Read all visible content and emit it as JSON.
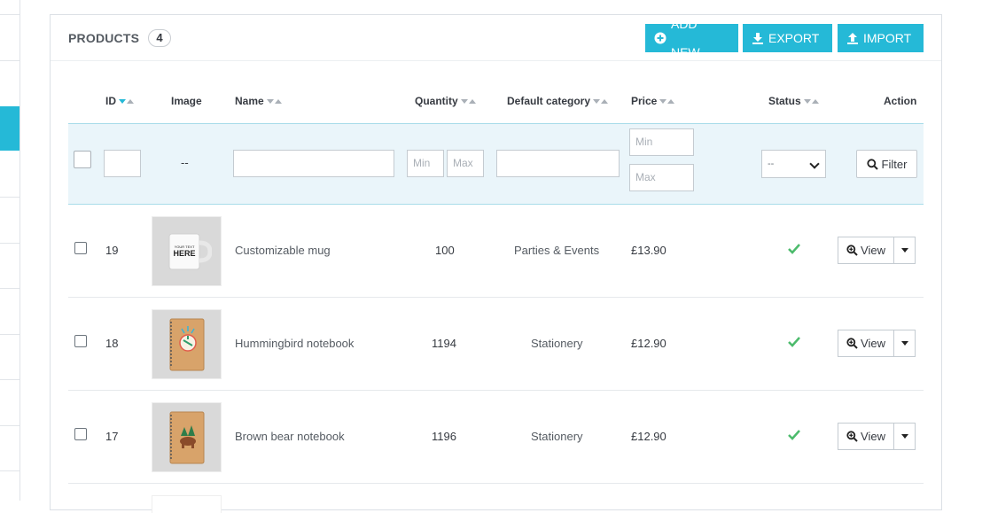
{
  "panel": {
    "title": "PRODUCTS",
    "count": "4",
    "buttons": {
      "add_new": "ADD NEW",
      "export": "EXPORT",
      "import": "IMPORT"
    }
  },
  "table": {
    "columns": {
      "id": "ID",
      "image": "Image",
      "name": "Name",
      "quantity": "Quantity",
      "category": "Default category",
      "price": "Price",
      "status": "Status",
      "action": "Action"
    },
    "filters": {
      "image_placeholder": "--",
      "qty_min_placeholder": "Min",
      "qty_max_placeholder": "Max",
      "price_min_placeholder": "Min",
      "price_max_placeholder": "Max",
      "status_selected": "--",
      "filter_button": "Filter"
    },
    "rows": [
      {
        "id": "19",
        "name": "Customizable mug",
        "quantity": "100",
        "category": "Parties & Events",
        "price": "£13.90",
        "status": "enabled",
        "image_icon": "mug-image",
        "image_text": "YOUR TEXT HERE",
        "view_label": "View"
      },
      {
        "id": "18",
        "name": "Hummingbird notebook",
        "quantity": "1194",
        "category": "Stationery",
        "price": "£12.90",
        "status": "enabled",
        "image_icon": "notebook-hummingbird-image",
        "view_label": "View"
      },
      {
        "id": "17",
        "name": "Brown bear notebook",
        "quantity": "1196",
        "category": "Stationery",
        "price": "£12.90",
        "status": "enabled",
        "image_icon": "notebook-bear-image",
        "view_label": "View"
      }
    ]
  },
  "colors": {
    "accent": "#25b9d7",
    "filter_bg": "#eaf5fa",
    "status_ok": "#4cbb6c"
  },
  "icons": {
    "add": "plus-circle-icon",
    "export": "download-icon",
    "import": "upload-icon",
    "search": "magnifier-icon",
    "zoom": "zoom-in-icon",
    "status": "check-icon"
  }
}
